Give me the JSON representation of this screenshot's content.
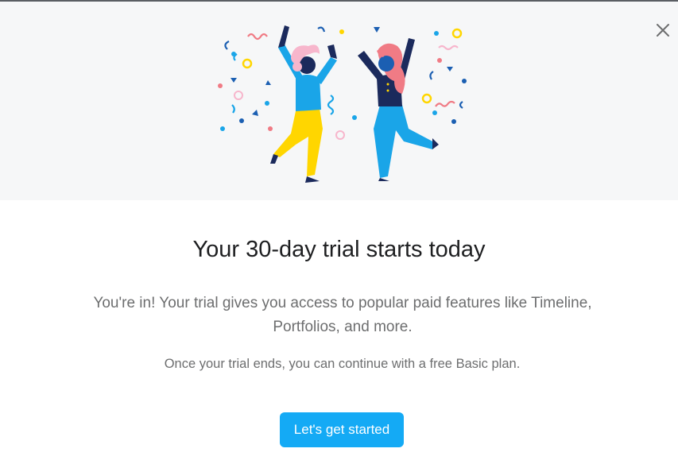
{
  "dialog": {
    "title": "Your 30-day trial starts today",
    "description": "You're in! Your trial gives you access to popular paid features like Timeline, Portfolios, and more.",
    "note": "Once your trial ends, you can continue with a free Basic plan.",
    "cta_label": "Let's get started",
    "close_icon": "close-icon",
    "illustration": "two-people-dancing-confetti"
  },
  "colors": {
    "accent": "#14aaf5",
    "hero_background": "#f6f7f8",
    "title_text": "#1e1f21",
    "body_text": "#6d6e6f"
  }
}
